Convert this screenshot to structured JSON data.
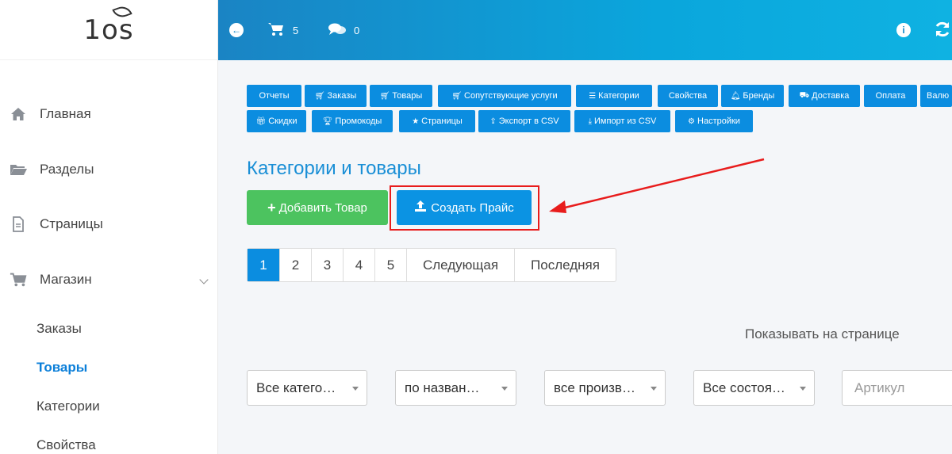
{
  "logo": {
    "text": "1os"
  },
  "sidebar": {
    "items": [
      {
        "label": "Главная",
        "icon": "home-icon"
      },
      {
        "label": "Разделы",
        "icon": "folder-icon"
      },
      {
        "label": "Страницы",
        "icon": "file-icon"
      },
      {
        "label": "Магазин",
        "icon": "cart-icon"
      }
    ],
    "subitems": [
      {
        "label": "Заказы",
        "active": false
      },
      {
        "label": "Товары",
        "active": true
      },
      {
        "label": "Категории",
        "active": false
      },
      {
        "label": "Свойства",
        "active": false
      }
    ]
  },
  "topbar": {
    "cart_count": "5",
    "messages_count": "0"
  },
  "tabs": {
    "row1": [
      {
        "label": "Отчеты",
        "icon": ""
      },
      {
        "label": "Заказы",
        "icon": "cart-icon"
      },
      {
        "label": "Товары",
        "icon": "cart-icon"
      },
      {
        "label": "Сопутствующие услуги",
        "icon": "cart-plus-icon"
      },
      {
        "label": "Категории",
        "icon": "list-icon"
      },
      {
        "label": "Свойства",
        "icon": ""
      },
      {
        "label": "Бренды",
        "icon": "bell-icon"
      },
      {
        "label": "Доставка",
        "icon": "truck-icon"
      },
      {
        "label": "Оплата",
        "icon": ""
      },
      {
        "label": "Валю",
        "icon": ""
      }
    ],
    "row2": [
      {
        "label": "Скидки",
        "icon": "gift-icon"
      },
      {
        "label": "Промокоды",
        "icon": "trophy-icon"
      },
      {
        "label": "Страницы",
        "icon": "star-icon"
      },
      {
        "label": "Экспорт в CSV",
        "icon": "upload-icon"
      },
      {
        "label": "Импорт из CSV",
        "icon": "download-icon"
      },
      {
        "label": "Настройки",
        "icon": "gear-icon"
      }
    ]
  },
  "main": {
    "title": "Категории и товары",
    "add_button": "Добавить Товар",
    "price_button": "Создать Прайс"
  },
  "pagination": {
    "pages": [
      "1",
      "2",
      "3",
      "4",
      "5"
    ],
    "next": "Следующая",
    "last": "Последняя",
    "active_page": "1"
  },
  "filters": {
    "per_page_label": "Показывать на странице",
    "category": "Все катего…",
    "sort": "по назван…",
    "producer": "все произв…",
    "state": "Все состоя…",
    "article_placeholder": "Артикул"
  },
  "colors": {
    "accent": "#0b8de0",
    "green": "#4cc35f",
    "title_blue": "#1a8fd6",
    "annotation_red": "#e81c1c"
  }
}
